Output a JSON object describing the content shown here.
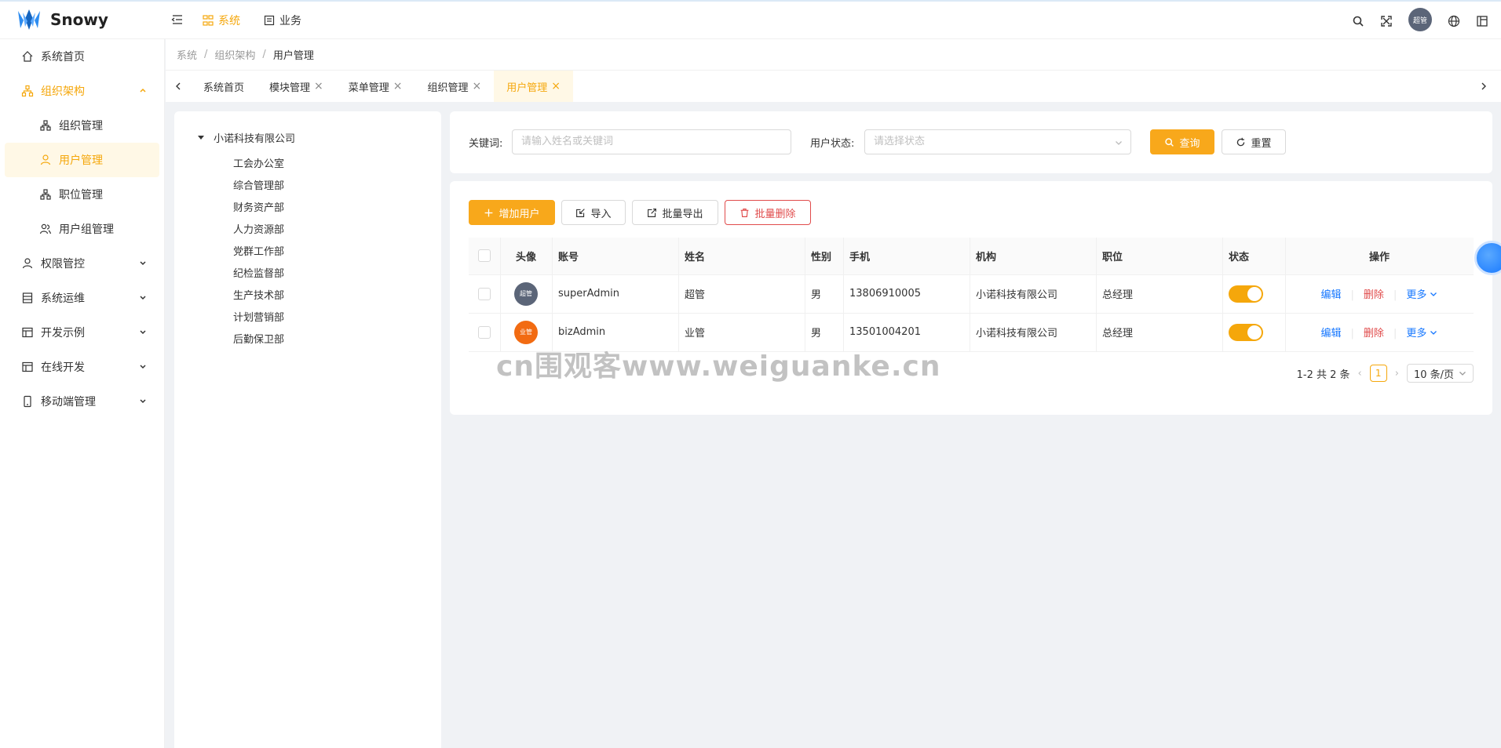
{
  "app": {
    "name": "Snowy"
  },
  "topnav": [
    {
      "label": "系统",
      "active": true
    },
    {
      "label": "业务",
      "active": false
    }
  ],
  "header": {
    "avatar_text": "超管"
  },
  "sidebar": {
    "items": [
      {
        "label": "系统首页",
        "icon": "home-icon"
      },
      {
        "label": "组织架构",
        "icon": "org-icon",
        "open": true,
        "children": [
          {
            "label": "组织管理",
            "icon": "cluster-icon"
          },
          {
            "label": "用户管理",
            "icon": "user-icon",
            "active": true
          },
          {
            "label": "职位管理",
            "icon": "apartment-icon"
          },
          {
            "label": "用户组管理",
            "icon": "usergroup-icon"
          }
        ]
      },
      {
        "label": "权限管控",
        "icon": "user-icon"
      },
      {
        "label": "系统运维",
        "icon": "database-icon"
      },
      {
        "label": "开发示例",
        "icon": "layout-icon"
      },
      {
        "label": "在线开发",
        "icon": "layout-icon"
      },
      {
        "label": "移动端管理",
        "icon": "mobile-icon"
      }
    ]
  },
  "breadcrumb": [
    "系统",
    "组织架构",
    "用户管理"
  ],
  "tabs": [
    {
      "label": "系统首页",
      "closable": false
    },
    {
      "label": "模块管理",
      "closable": true
    },
    {
      "label": "菜单管理",
      "closable": true
    },
    {
      "label": "组织管理",
      "closable": true
    },
    {
      "label": "用户管理",
      "closable": true,
      "active": true
    }
  ],
  "tree": {
    "root": "小诺科技有限公司",
    "children": [
      "工会办公室",
      "综合管理部",
      "财务资产部",
      "人力资源部",
      "党群工作部",
      "纪检监督部",
      "生产技术部",
      "计划营销部",
      "后勤保卫部"
    ]
  },
  "search": {
    "keyword_label": "关键词:",
    "keyword_placeholder": "请输入姓名或关键词",
    "status_label": "用户状态:",
    "status_placeholder": "请选择状态",
    "query_label": "查询",
    "reset_label": "重置"
  },
  "toolbar": {
    "add_label": "增加用户",
    "import_label": "导入",
    "export_label": "批量导出",
    "delete_label": "批量删除"
  },
  "table": {
    "columns": [
      "头像",
      "账号",
      "姓名",
      "性别",
      "手机",
      "机构",
      "职位",
      "状态",
      "操作"
    ],
    "rows": [
      {
        "avatar_text": "超管",
        "avatar_color": "#5b6578",
        "account": "superAdmin",
        "name": "超管",
        "gender": "男",
        "phone": "13806910005",
        "org": "小诺科技有限公司",
        "position": "总经理",
        "status": true
      },
      {
        "avatar_text": "业管",
        "avatar_color": "#f26b12",
        "account": "bizAdmin",
        "name": "业管",
        "gender": "男",
        "phone": "13501004201",
        "org": "小诺科技有限公司",
        "position": "总经理",
        "status": true
      }
    ],
    "ops": {
      "edit": "编辑",
      "delete": "删除",
      "more": "更多"
    }
  },
  "pagination": {
    "summary": "1-2 共 2 条",
    "current": "1",
    "page_size": "10 条/页"
  },
  "watermark": "cn围观客www.weiguanke.cn",
  "colors": {
    "accent": "#f5a70b",
    "link": "#1677ff",
    "danger": "#e04b4b"
  }
}
